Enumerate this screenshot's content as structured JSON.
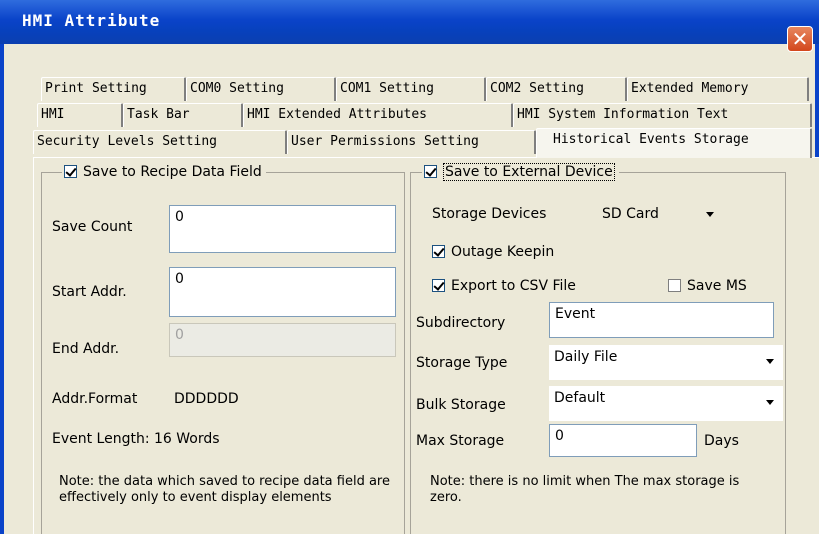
{
  "window": {
    "title": "HMI Attribute",
    "close_glyph": "✕"
  },
  "tabs": {
    "row1": [
      "Print Setting",
      "COM0 Setting",
      "COM1 Setting",
      "COM2 Setting",
      "Extended Memory"
    ],
    "row2": [
      "HMI",
      "Task Bar",
      "HMI Extended Attributes",
      "HMI System Information Text"
    ],
    "row3": [
      "Security Levels Setting",
      "User Permissions Setting",
      "Historical Events Storage"
    ],
    "active": "Historical Events Storage"
  },
  "recipe": {
    "label": "Save to Recipe Data Field",
    "checked": true,
    "save_count_label": "Save Count",
    "save_count_value": "0",
    "start_addr_label": "Start Addr.",
    "start_addr_value": "0",
    "end_addr_label": "End Addr.",
    "end_addr_value": "0",
    "addr_format_label": "Addr.Format",
    "addr_format_value": "DDDDDD",
    "event_length": "Event Length: 16 Words",
    "note": "Note: the data which saved to recipe data field are effectively only to event display elements"
  },
  "external": {
    "label": "Save to External Device",
    "checked": true,
    "storage_devices_label": "Storage Devices",
    "storage_devices_value": "SD Card",
    "outage_keepin_label": "Outage Keepin",
    "outage_keepin_checked": true,
    "export_csv_label": "Export to CSV File",
    "export_csv_checked": true,
    "save_ms_label": "Save MS",
    "save_ms_checked": false,
    "subdirectory_label": "Subdirectory",
    "subdirectory_value": "Event",
    "storage_type_label": "Storage Type",
    "storage_type_value": "Daily File",
    "bulk_storage_label": "Bulk Storage",
    "bulk_storage_value": "Default",
    "max_storage_label": "Max Storage",
    "max_storage_value": "0",
    "max_storage_unit": "Days",
    "note": "Note: there is no limit when The max storage is zero."
  }
}
